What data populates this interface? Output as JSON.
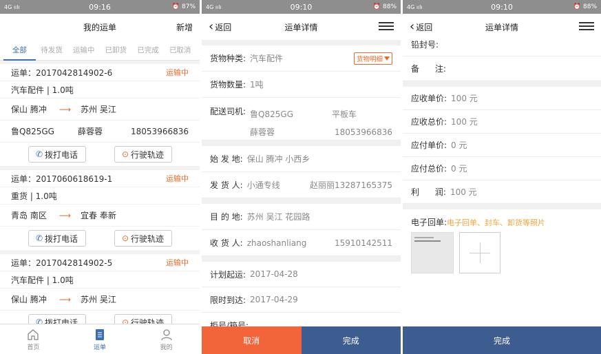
{
  "status_bars": [
    {
      "left": "4G ıılı",
      "time": "09:16",
      "right": "⏰ 87%"
    },
    {
      "left": "4G ıılı",
      "time": "09:10",
      "right": "⏰ 88%"
    },
    {
      "left": "4G ıılı",
      "time": "09:10",
      "right": "⏰ 88%"
    }
  ],
  "list_screen": {
    "title": "我的运单",
    "add": "新增",
    "tabs": [
      "全部",
      "待发货",
      "运输中",
      "已卸货",
      "已完成",
      "已取消"
    ],
    "orders": [
      {
        "no": "运单：2017042814902-6",
        "status": "运输中",
        "cargo": "汽车配件 | 1.0吨",
        "from": "保山 腾冲",
        "to": "苏州 吴江",
        "plate": "鲁Q825GG",
        "driver": "薛蓉蓉",
        "phone": "18053966836",
        "call": "拨打电话",
        "track": "行驶轨迹"
      },
      {
        "no": "运单：2017060618619-1",
        "status": "运输中",
        "cargo": "重货 | 1.0吨",
        "from": "青岛 南区",
        "to": "宜春 奉新",
        "call": "拨打电话",
        "track": "行驶轨迹"
      },
      {
        "no": "运单：2017042814902-5",
        "status": "运输中",
        "cargo": "汽车配件 | 1.0吨",
        "from": "保山 腾冲",
        "to": "苏州 吴江",
        "call": "拨打电话",
        "track": "行驶轨迹"
      }
    ],
    "tabbar": [
      "首页",
      "运单",
      "我的"
    ]
  },
  "detail_screen": {
    "back": "返回",
    "title": "运单详情",
    "cargo_type_label": "货物种类:",
    "cargo_type": "汽车配件",
    "cargo_detail": "货物明细",
    "qty_label": "货物数量:",
    "qty": "1吨",
    "driver_label": "配送司机:",
    "plate": "鲁Q825GG",
    "truck": "平板车",
    "driver": "薛蓉蓉",
    "driver_phone": "18053966836",
    "origin_label": "始 发 地:",
    "origin": "保山 腾冲  小西乡",
    "shipper_label": "发 货 人:",
    "shipper": "小通专线",
    "shipper_contact": "赵丽丽13287165375",
    "dest_label": "目 的 地:",
    "dest": "苏州 吴江  花园路",
    "consignee_label": "收 货 人:",
    "consignee": "zhaoshanliang",
    "consignee_phone": "15910142511",
    "plan_label": "计划起运:",
    "plan": "2017-04-28",
    "limit_label": "限时到达:",
    "limit": "2017-04-29",
    "container_label": "柜号/箱号:",
    "cancel": "取消",
    "done": "完成"
  },
  "detail_screen2": {
    "back": "返回",
    "title": "运单详情",
    "seal_label": "铅封号:",
    "remark_label": "备      注:",
    "fees": [
      {
        "label": "应收单价:",
        "value": "100 元"
      },
      {
        "label": "应收总价:",
        "value": "100 元"
      },
      {
        "label": "应付单价:",
        "value": "0 元"
      },
      {
        "label": "应付总价:",
        "value": "0 元"
      },
      {
        "label": "利      润:",
        "value": "100 元"
      }
    ],
    "receipt_label": "电子回单:",
    "receipt_hint": "电子回单、封车、卸货等照片",
    "done": "完成"
  }
}
